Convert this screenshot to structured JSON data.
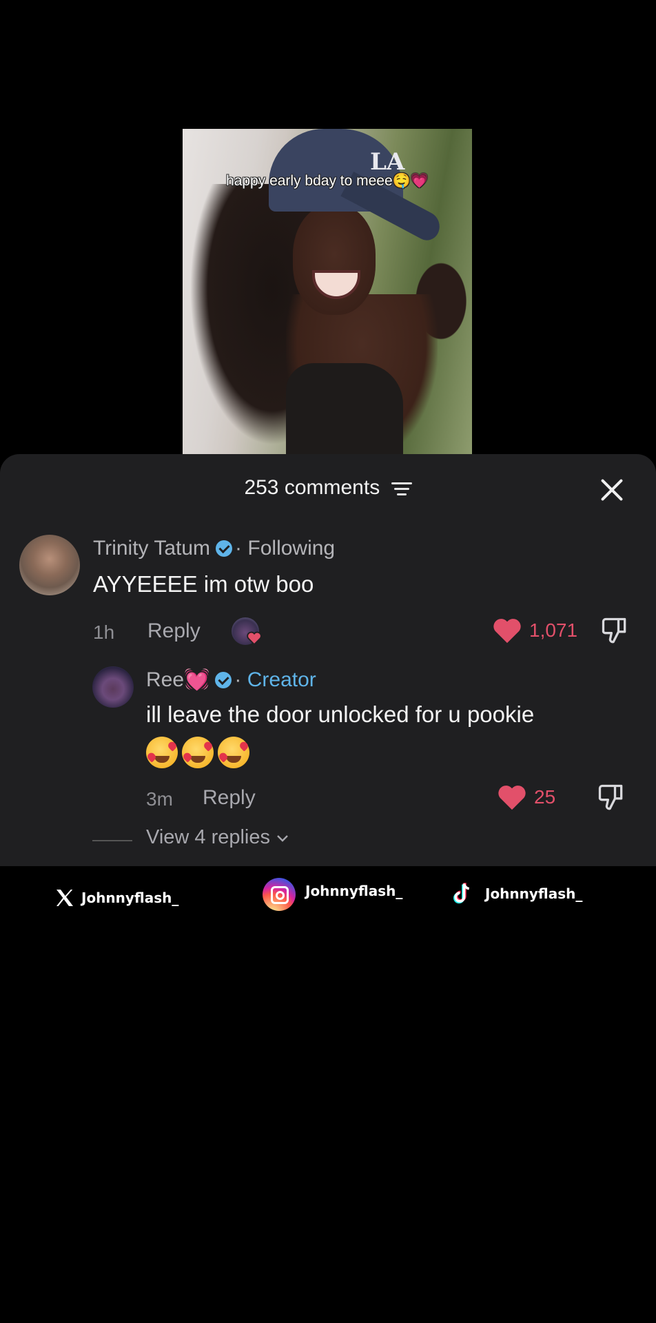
{
  "video": {
    "caption": "happy early bday to meee🤤💗",
    "cap_logo": "LA"
  },
  "comments_panel": {
    "count_label": "253 comments",
    "filter_icon": "filter-lines-icon",
    "close_icon": "close-icon"
  },
  "comment": {
    "author": "Trinity Tatum",
    "relation": "Following",
    "separator": "·",
    "text": "AYYEEEE im otw boo",
    "time": "1h",
    "reply_label": "Reply",
    "likes": "1,071"
  },
  "reply": {
    "author": "Ree💓",
    "relation": "Creator",
    "separator": "·",
    "text": "ill leave the door unlocked for u pookie",
    "emojis": "🥰🥰🥰",
    "time": "3m",
    "reply_label": "Reply",
    "likes": "25"
  },
  "view_replies": "View 4 replies",
  "colors": {
    "like_red": "#e2506a",
    "verified_blue": "#5fb4e9",
    "sheet_bg": "#1f1f21"
  },
  "footer": {
    "x_handle": "Johnnyflash_",
    "instagram_handle": "Johnnyflash_",
    "tiktok_handle": "Johnnyflash_"
  }
}
